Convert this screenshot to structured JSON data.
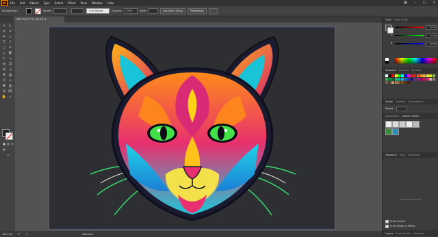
{
  "menu": {
    "logo": "Ai",
    "items": [
      "File",
      "Edit",
      "Object",
      "Type",
      "Select",
      "Effect",
      "View",
      "Window",
      "Help"
    ]
  },
  "control": {
    "selection": "No Selection",
    "stroke_label": "Stroke:",
    "stroke_profile": "5 pt. Round",
    "opacity_label": "Opacity:",
    "opacity_value": "100%",
    "style_label": "Style:",
    "doc_setup": "Document Setup",
    "preferences": "Preferences"
  },
  "document": {
    "tab_title": "WET Art.ai* @ 104.16 % (RGB/Preview)"
  },
  "status": {
    "zoom": "104.16%",
    "angle": "0°",
    "artboard": "1",
    "tool": "Selection"
  },
  "panels": {
    "color_tabs": [
      "Color",
      "Color Guide"
    ],
    "color_labels": [
      "R",
      "G",
      "B"
    ],
    "color_values": [
      "76.76",
      "76.29",
      "80.08"
    ],
    "swatch_tabs": [
      "Swatches",
      "Brushes",
      "Symbols"
    ],
    "stroke_tabs": [
      "Stroke",
      "Gradient",
      "Transparency"
    ],
    "stroke_weight_label": "Weight:",
    "appearance_tabs": [
      "Appearance",
      "Graphic Styles"
    ],
    "transform_tabs": [
      "Transform",
      "Align",
      "Pathfinder"
    ],
    "no_shape": "No Shape Properties",
    "scale_corners": "Scale Corners",
    "scale_strokes": "Scale Strokes & Effects",
    "bottom_tabs": [
      "Layers",
      "Asset Export",
      "Artboards"
    ]
  },
  "colors": {
    "menubar": "#323232",
    "workspace": "#535353",
    "artboard": "#2e2f33",
    "accent": "#ff9a00"
  }
}
